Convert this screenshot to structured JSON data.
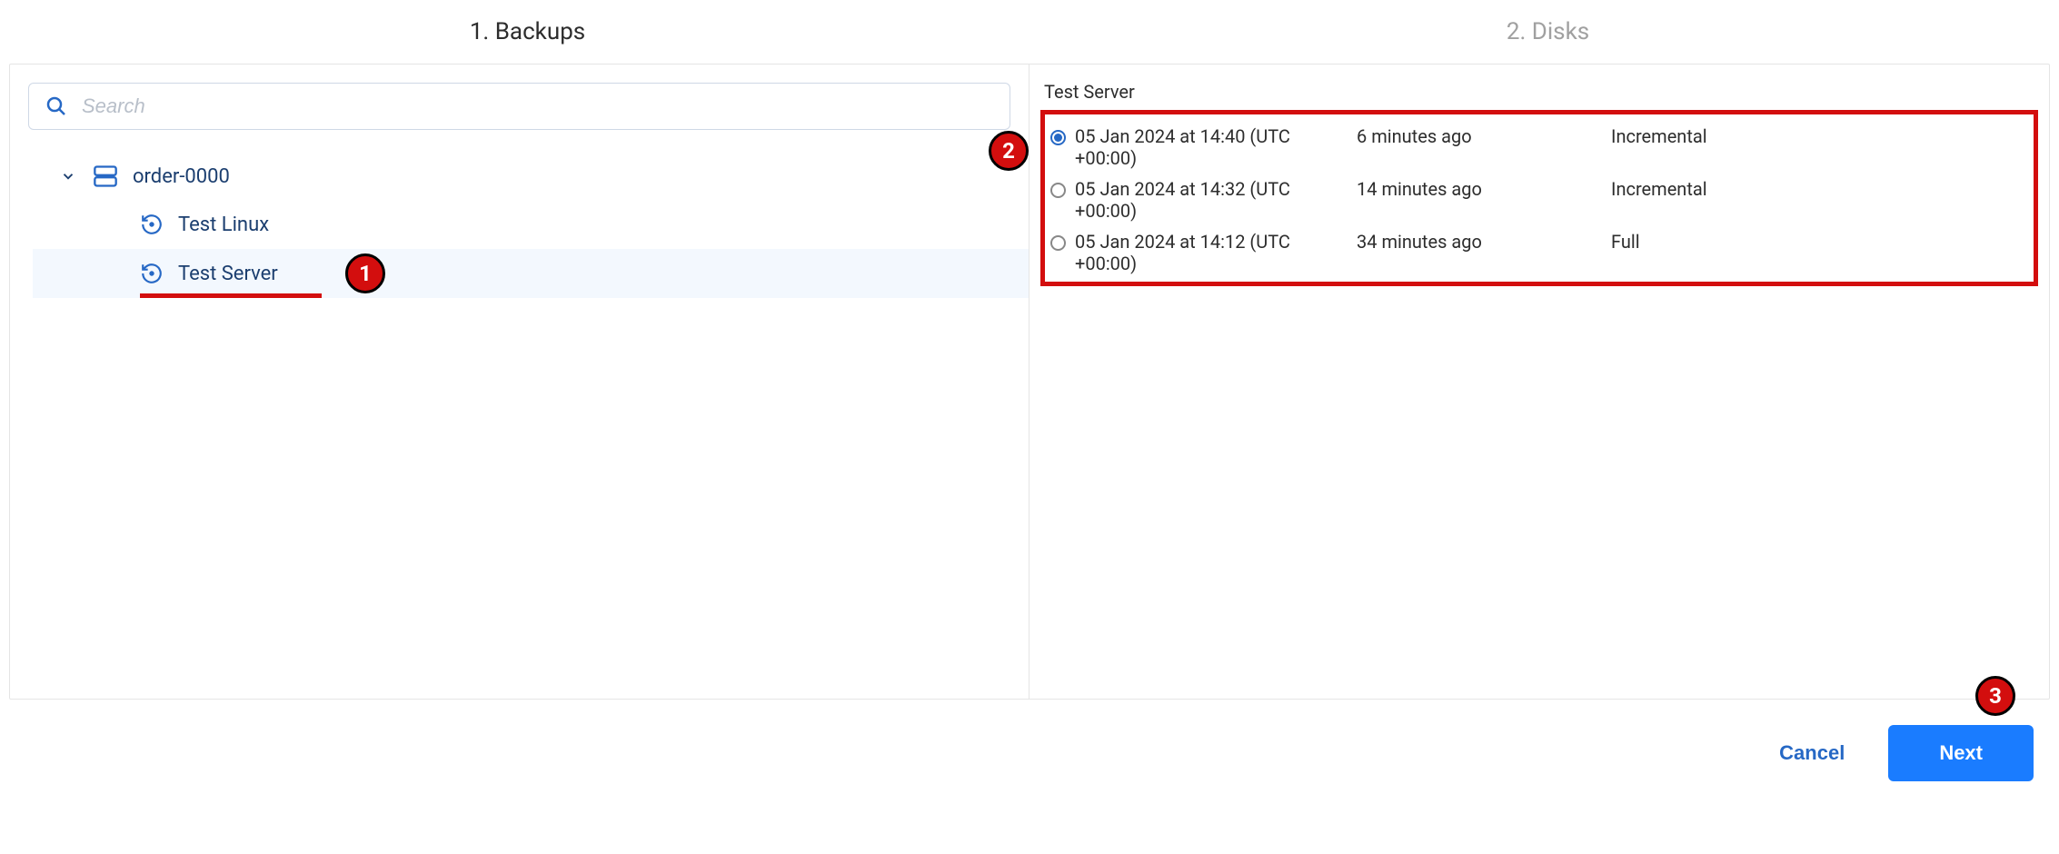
{
  "steps": {
    "step1": "1. Backups",
    "step2": "2. Disks"
  },
  "search": {
    "placeholder": "Search"
  },
  "tree": {
    "root": {
      "label": "order-0000"
    },
    "items": [
      {
        "label": "Test Linux",
        "selected": false
      },
      {
        "label": "Test Server",
        "selected": true
      }
    ]
  },
  "rightPanel": {
    "title": "Test Server",
    "backups": [
      {
        "datetime": "05 Jan 2024 at 14:40 (UTC +00:00)",
        "age": "6 minutes ago",
        "type": "Incremental",
        "selected": true
      },
      {
        "datetime": "05 Jan 2024 at 14:32 (UTC +00:00)",
        "age": "14 minutes ago",
        "type": "Incremental",
        "selected": false
      },
      {
        "datetime": "05 Jan 2024 at 14:12 (UTC +00:00)",
        "age": "34 minutes ago",
        "type": "Full",
        "selected": false
      }
    ]
  },
  "footer": {
    "cancel": "Cancel",
    "next": "Next"
  },
  "annotations": {
    "b1": "1",
    "b2": "2",
    "b3": "3"
  }
}
